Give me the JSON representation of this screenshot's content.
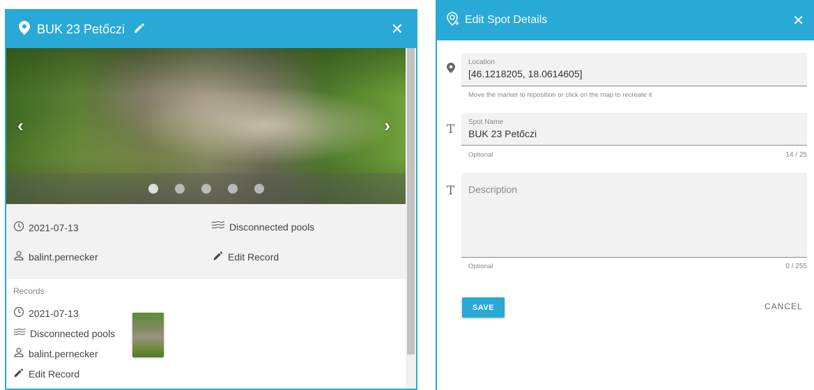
{
  "spot_panel": {
    "title": "BUK 23 Petőczi",
    "close_label": "✕",
    "carousel": {
      "prev": "‹",
      "next": "›",
      "dot_count": 5,
      "active_index": 0
    },
    "info": {
      "date": "2021-07-13",
      "status": "Disconnected pools",
      "user": "balint.pernecker",
      "edit_label": "Edit Record"
    },
    "records": {
      "title": "Records",
      "items": [
        {
          "date": "2021-07-13",
          "status": "Disconnected pools",
          "user": "balint.pernecker",
          "edit_label": "Edit Record"
        }
      ]
    }
  },
  "edit_panel": {
    "title": "Edit Spot Details",
    "close_label": "✕",
    "location": {
      "label": "Location",
      "value": "[46.1218205, 18.0614605]",
      "helper": "Move the marker to reposition or click on the map to recreate it"
    },
    "spot_name": {
      "label": "Spot Name",
      "value": "BUK 23 Petőczi",
      "helper": "Optional",
      "counter": "14 / 25"
    },
    "description": {
      "placeholder": "Description",
      "helper": "Optional",
      "counter": "0 / 255"
    },
    "save_label": "SAVE",
    "cancel_label": "CANCEL"
  },
  "colors": {
    "accent": "#29a9d6",
    "panel_bg": "#f2f2f2"
  }
}
